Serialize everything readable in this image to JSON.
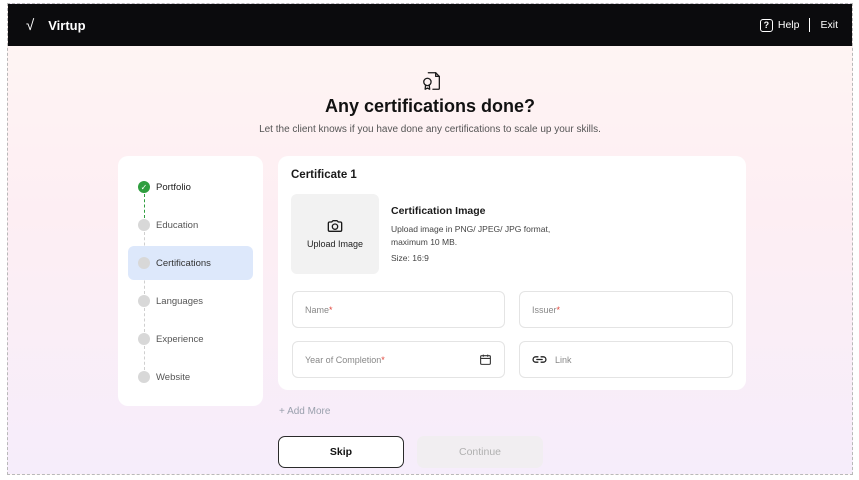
{
  "topbar": {
    "logo_mark": "√",
    "app_name": "Virtup",
    "help_icon_glyph": "?",
    "help_label": "Help",
    "exit_label": "Exit"
  },
  "hero": {
    "icon": "certificate-icon",
    "title": "Any certifications done?",
    "subtitle": "Let the client knows if you have done any certifications to scale up your skills."
  },
  "steps": {
    "items": [
      {
        "label": "Portfolio",
        "state": "done"
      },
      {
        "label": "Education",
        "state": "pending"
      },
      {
        "label": "Certifications",
        "state": "active"
      },
      {
        "label": "Languages",
        "state": "pending"
      },
      {
        "label": "Experience",
        "state": "pending"
      },
      {
        "label": "Website",
        "state": "pending"
      }
    ],
    "colors": {
      "done": "#2f9e3f",
      "active_bg": "#dde8fb"
    }
  },
  "certificate": {
    "card_title": "Certificate 1",
    "upload": {
      "icon": "camera-icon",
      "label": "Upload Image"
    },
    "image_info": {
      "title": "Certification Image",
      "desc_line1": "Upload image in PNG/ JPEG/ JPG format,",
      "desc_line2": "maximum 10 MB.",
      "size": "Size: 16:9"
    },
    "fields": {
      "name": {
        "placeholder": "Name",
        "required_mark": "*"
      },
      "issuer": {
        "placeholder": "Issuer",
        "required_mark": "*"
      },
      "year": {
        "placeholder": "Year of Completion",
        "required_mark": "*",
        "icon": "calendar-icon"
      },
      "link": {
        "placeholder": "Link",
        "icon": "link-icon"
      }
    }
  },
  "actions": {
    "add_more": "+ Add More",
    "skip": "Skip",
    "continue": "Continue"
  },
  "colors": {
    "topbar_bg": "#0b0b0d",
    "required": "#e0453a",
    "continue_disabled_bg": "#f1eef1"
  }
}
